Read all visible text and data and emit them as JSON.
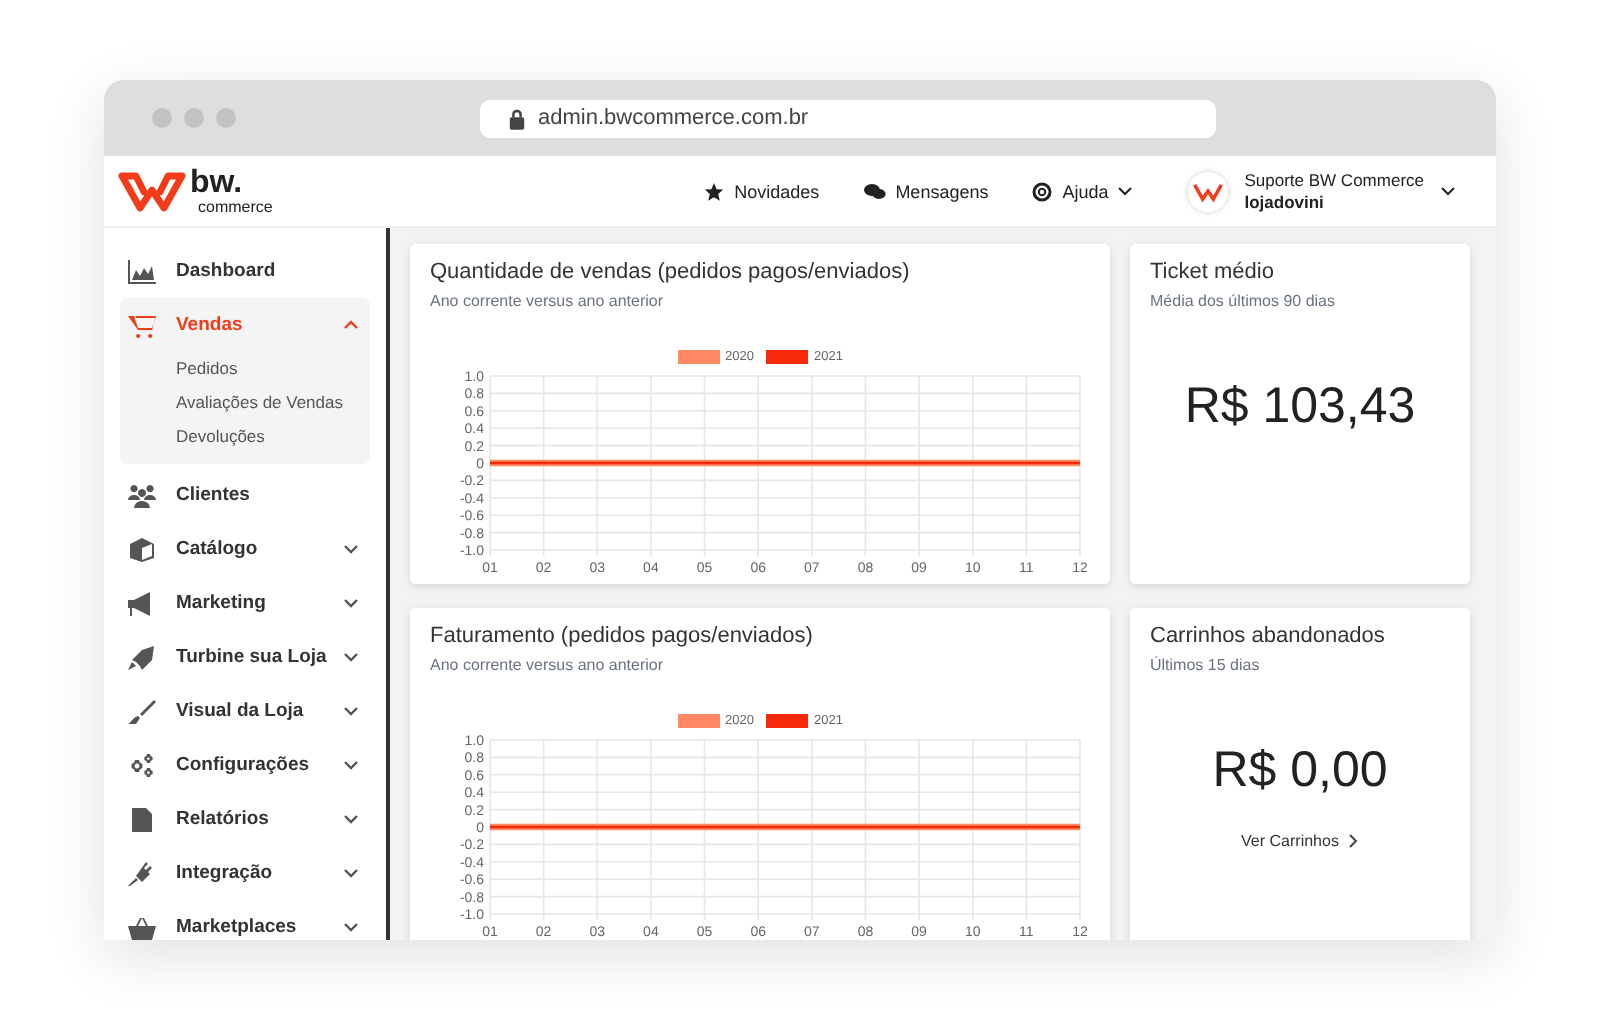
{
  "browser": {
    "url": "admin.bwcommerce.com.br"
  },
  "logo": {
    "name": "bw.",
    "tagline": "commerce"
  },
  "topnav": [
    {
      "label": "Novidades",
      "kind": "star"
    },
    {
      "label": "Mensagens",
      "kind": "chat"
    },
    {
      "label": "Ajuda",
      "kind": "help"
    }
  ],
  "user": {
    "line1": "Suporte BW Commerce",
    "line2": "lojadovini"
  },
  "sidebar": {
    "items": [
      {
        "label": "Dashboard",
        "selected": false
      },
      {
        "label": "Vendas",
        "selected": true,
        "expanded": true,
        "children": [
          {
            "label": "Pedidos"
          },
          {
            "label": "Avaliações de Vendas"
          },
          {
            "label": "Devoluções"
          }
        ]
      },
      {
        "label": "Clientes",
        "selected": false
      },
      {
        "label": "Catálogo",
        "selected": false,
        "expanded": false
      },
      {
        "label": "Marketing",
        "selected": false,
        "expanded": false
      },
      {
        "label": "Turbine sua Loja",
        "selected": false,
        "expanded": false
      },
      {
        "label": "Visual da Loja",
        "selected": false,
        "expanded": false
      },
      {
        "label": "Configurações",
        "selected": false,
        "expanded": false
      },
      {
        "label": "Relatórios",
        "selected": false,
        "expanded": false
      },
      {
        "label": "Integração",
        "selected": false,
        "expanded": false
      },
      {
        "label": "Marketplaces",
        "selected": false,
        "expanded": false
      }
    ]
  },
  "charts": [
    {
      "title": "Quantidade de vendas (pedidos pagos/enviados)",
      "subtitle": "Ano corrente versus ano anterior",
      "chart_data": {
        "type": "line",
        "grid": true,
        "categories": [
          "01",
          "02",
          "03",
          "04",
          "05",
          "06",
          "07",
          "08",
          "09",
          "10",
          "11",
          "12"
        ],
        "ylim": [
          -1,
          1
        ],
        "yticks": [
          {
            "value": 1,
            "label": "1.0"
          },
          {
            "value": 0.8,
            "label": "0.8"
          },
          {
            "value": 0.6,
            "label": "0.6"
          },
          {
            "value": 0.4,
            "label": "0.4"
          },
          {
            "value": 0.2,
            "label": "0.2"
          },
          {
            "value": 0,
            "label": "0"
          },
          {
            "value": -0.2,
            "label": "-0.2"
          },
          {
            "value": -0.4,
            "label": "-0.4"
          },
          {
            "value": -0.6,
            "label": "-0.6"
          },
          {
            "value": -0.8,
            "label": "-0.8"
          },
          {
            "value": -1,
            "label": "-1.0"
          }
        ],
        "series": [
          {
            "name": "2020",
            "color": "#ff8a65",
            "values": [
              0,
              0,
              0,
              0,
              0,
              0,
              0,
              0,
              0,
              0,
              0,
              0
            ]
          },
          {
            "name": "2021",
            "color": "#f52a0a",
            "values": [
              0,
              0,
              0,
              0,
              0,
              0,
              0,
              0,
              0,
              0,
              0,
              0
            ]
          }
        ]
      }
    },
    {
      "title": "Faturamento (pedidos pagos/enviados)",
      "subtitle": "Ano corrente versus ano anterior",
      "chart_data": {
        "type": "line",
        "grid": true,
        "categories": [
          "01",
          "02",
          "03",
          "04",
          "05",
          "06",
          "07",
          "08",
          "09",
          "10",
          "11",
          "12"
        ],
        "ylim": [
          -1,
          1
        ],
        "yticks": [
          {
            "value": 1,
            "label": "1.0"
          },
          {
            "value": 0.8,
            "label": "0.8"
          },
          {
            "value": 0.6,
            "label": "0.6"
          },
          {
            "value": 0.4,
            "label": "0.4"
          },
          {
            "value": 0.2,
            "label": "0.2"
          },
          {
            "value": 0,
            "label": "0"
          },
          {
            "value": -0.2,
            "label": "-0.2"
          },
          {
            "value": -0.4,
            "label": "-0.4"
          },
          {
            "value": -0.6,
            "label": "-0.6"
          },
          {
            "value": -0.8,
            "label": "-0.8"
          },
          {
            "value": -1,
            "label": "-1.0"
          }
        ],
        "series": [
          {
            "name": "2020",
            "color": "#ff8a65",
            "values": [
              0,
              0,
              0,
              0,
              0,
              0,
              0,
              0,
              0,
              0,
              0,
              0
            ]
          },
          {
            "name": "2021",
            "color": "#f52a0a",
            "values": [
              0,
              0,
              0,
              0,
              0,
              0,
              0,
              0,
              0,
              0,
              0,
              0
            ]
          }
        ]
      }
    }
  ],
  "stats": [
    {
      "title": "Ticket médio",
      "subtitle": "Média dos últimos 90 dias",
      "value": "R$ 103,43"
    },
    {
      "title": "Carrinhos abandonados",
      "subtitle": "Últimos 15 dias",
      "value": "R$ 0,00",
      "link": "Ver Carrinhos"
    }
  ]
}
